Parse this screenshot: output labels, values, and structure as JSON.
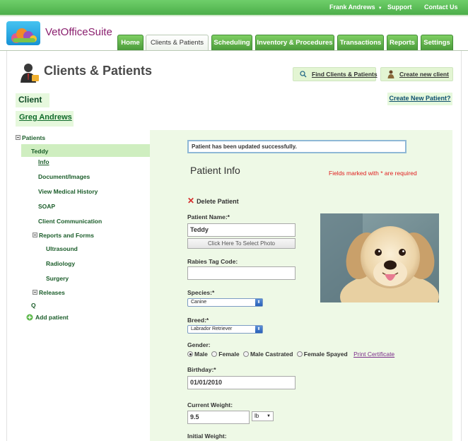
{
  "topbar": {
    "user_name": "Frank Andrews",
    "support": "Support",
    "contact": "Contact Us"
  },
  "brand": {
    "name": "VetOfficeSuite"
  },
  "nav": {
    "tabs": [
      {
        "label": "Home",
        "active": false
      },
      {
        "label": "Clients & Patients",
        "active": true
      },
      {
        "label": "Scheduling",
        "active": false
      },
      {
        "label": "Inventory & Procedures",
        "active": false
      },
      {
        "label": "Transactions",
        "active": false
      },
      {
        "label": "Reports",
        "active": false
      },
      {
        "label": "Settings",
        "active": false
      }
    ]
  },
  "page": {
    "title": "Clients & Patients",
    "find_button": "Find Clients & Patients",
    "create_client_button": "Create new client"
  },
  "client": {
    "section_label": "Client",
    "name": "Greg Andrews",
    "create_patient_link": "Create New Patient?"
  },
  "sidebar": {
    "patients_label": "Patients",
    "selected_patient": "Teddy",
    "items": [
      "Info",
      "Document/Images",
      "View Medical History",
      "SOAP",
      "Client Communication"
    ],
    "reports_label": "Reports and Forms",
    "reports_items": [
      "Ultrasound",
      "Radiology",
      "Surgery"
    ],
    "releases_label": "Releases",
    "extra_item": "Q",
    "add_patient": "Add patient"
  },
  "form": {
    "success_message": "Patient has been updated successfully.",
    "title": "Patient Info",
    "required_note": "Fields marked with * are required",
    "delete_label": "Delete Patient",
    "patient_name_label": "Patient Name:*",
    "patient_name_value": "Teddy",
    "photo_button": "Click Here To Select Photo",
    "rabies_label": "Rabies Tag Code:",
    "rabies_value": "",
    "species_label": "Species:*",
    "species_value": "Canine",
    "breed_label": "Breed:*",
    "breed_value": "Labrador Retriever",
    "gender_label": "Gender:",
    "gender_options": [
      "Male",
      "Female",
      "Male Castrated",
      "Female Spayed"
    ],
    "gender_selected": "Male",
    "print_certificate": "Print Certificate",
    "birthday_label": "Birthday:*",
    "birthday_value": "01/01/2010",
    "current_weight_label": "Current Weight:",
    "current_weight_value": "9.5",
    "weight_unit": "lb",
    "initial_weight_label": "Initial Weight:"
  },
  "colors": {
    "brand_green": "#4cae4a",
    "panel_bg": "#eef9e6",
    "required_red": "#e02020",
    "link_purple": "#7b2c8a"
  }
}
